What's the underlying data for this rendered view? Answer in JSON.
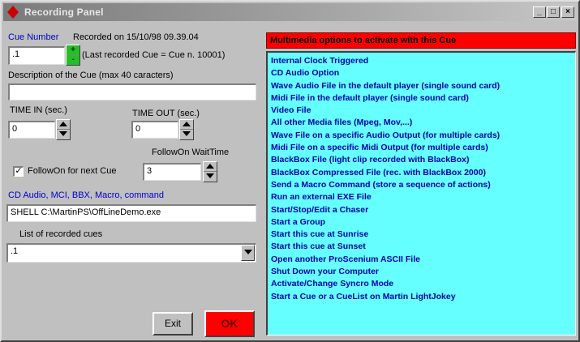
{
  "window": {
    "title": "Recording Panel",
    "min_glyph": "_",
    "max_glyph": "□",
    "close_glyph": "×"
  },
  "cue": {
    "number_label": "Cue Number",
    "recorded_on": "Recorded on 15/10/98 09.39.04",
    "number_value": ".1",
    "spin_up": "+",
    "spin_down": "-",
    "last_recorded": "(Last recorded Cue = Cue n. 10001)"
  },
  "description": {
    "label": "Description of the Cue (max 40 caracters)",
    "value": ""
  },
  "time_in": {
    "label": "TIME IN (sec.)",
    "value": "0"
  },
  "time_out": {
    "label": "TIME OUT (sec.)",
    "value": "0"
  },
  "followon": {
    "wait_label": "FollowOn WaitTime",
    "checkbox_label": "FollowOn for next Cue",
    "checked_glyph": "✓",
    "wait_value": "3"
  },
  "command": {
    "label": "CD Audio, MCI, BBX, Macro, command",
    "value": "SHELL C:\\MartinPS\\OffLineDemo.exe"
  },
  "recorded_cues": {
    "label": "List of recorded cues",
    "selected": ".1"
  },
  "buttons": {
    "exit": "Exit",
    "ok": "OK"
  },
  "multimedia": {
    "header": "Multimedia options to activate with this Cue",
    "options": [
      "Internal Clock Triggered",
      "CD Audio Option",
      "Wave Audio File in the default player (single sound card)",
      "Midi File in the default player (single sound card)",
      "Video File",
      "All other Media files (Mpeg, Mov,...)",
      "Wave File on a specific Audio Output (for multiple cards)",
      "Midi File on a specific Midi Output (for multiple cards)",
      "BlackBox File (light clip recorded with BlackBox)",
      "BlackBox Compressed File (rec. with BlackBox 2000)",
      "Send a Macro Command (store a sequence of actions)",
      "Run an external EXE File",
      "Start/Stop/Edit a Chaser",
      "Start a Group",
      "Start this cue at Sunrise",
      "Start this cue at Sunset",
      "Open another ProScenium ASCII File",
      "Shut Down your Computer",
      "Activate/Change Syncro Mode",
      "Start a Cue or a CueList on Martin LightJokey"
    ]
  },
  "colors": {
    "accent_red": "#ff0000",
    "options_bg": "#66ffff",
    "link_blue": "#0000aa"
  }
}
